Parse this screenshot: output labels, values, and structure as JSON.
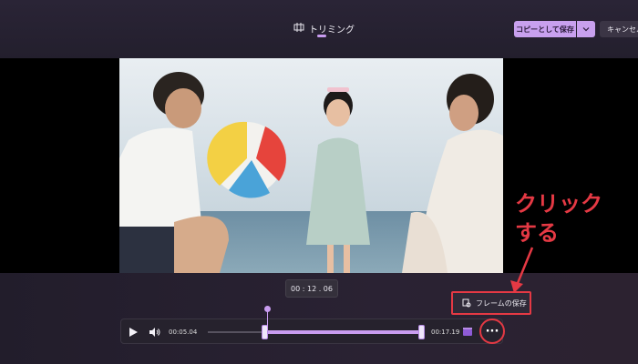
{
  "header": {
    "tab_label": "トリミング",
    "save_copy_label": "コピーとして保存",
    "cancel_label": "キャンセル"
  },
  "video": {
    "current_time": "00 : 12 . 06"
  },
  "controls": {
    "start_time": "00:05.04",
    "end_time": "00:17.19",
    "save_frame_label": "フレームの保存",
    "trim_start_fraction": 0.27,
    "trim_end_fraction": 1.0,
    "playhead_fraction": 0.58
  },
  "annotation": {
    "line1": "クリック",
    "line2": "する"
  },
  "colors": {
    "accent": "#c99cf0",
    "highlight": "#e53944",
    "background": "#1e1b26"
  },
  "icons": {
    "tab": "trim-icon",
    "dropdown": "chevron-down-icon",
    "play": "play-icon",
    "volume": "volume-icon",
    "save_frame": "save-frame-icon",
    "clip": "clip-icon",
    "more": "more-icon"
  }
}
